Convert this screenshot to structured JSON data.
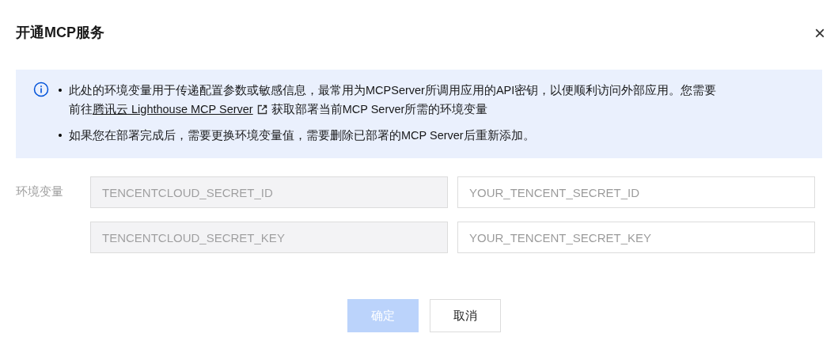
{
  "dialog": {
    "title": "开通MCP服务",
    "close": "×"
  },
  "notice": {
    "items": [
      {
        "text": "此处的环境变量用于传递配置参数或敏感信息，最常用为MCPServer所调用应用的API密钥，以便顺利访问外部应用。您需要",
        "line2_before": "前往",
        "link": "腾讯云 Lighthouse MCP Server",
        "line2_after": "获取部署当前MCP Server所需的环境变量"
      },
      {
        "text": "如果您在部署完成后，需要更换环境变量值，需要删除已部署的MCP Server后重新添加。"
      }
    ]
  },
  "env": {
    "label": "环境变量",
    "rows": [
      {
        "key": {
          "value": "TENCENTCLOUD_SECRET_ID",
          "disabled": true
        },
        "value": {
          "placeholder": "YOUR_TENCENT_SECRET_ID"
        }
      },
      {
        "key": {
          "value": "TENCENTCLOUD_SECRET_KEY",
          "disabled": true
        },
        "value": {
          "placeholder": "YOUR_TENCENT_SECRET_KEY"
        }
      }
    ]
  },
  "buttons": [
    {
      "label": "确定",
      "kind": "primary",
      "disabled": true
    },
    {
      "label": "取消",
      "kind": "default",
      "disabled": false
    }
  ]
}
